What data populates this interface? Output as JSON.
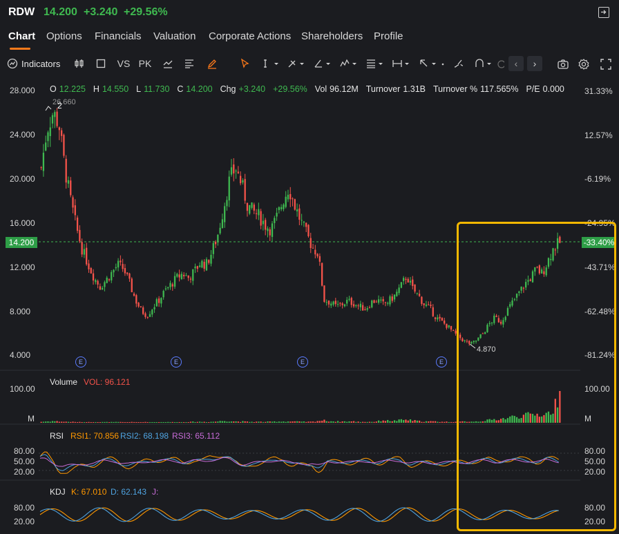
{
  "header": {
    "symbol": "RDW",
    "price": "14.200",
    "change": "+3.240",
    "change_pct": "+29.56%",
    "up_color": "#3fb950",
    "down_color": "#f5534a"
  },
  "tabs": [
    "Chart",
    "Options",
    "Financials",
    "Valuation",
    "Corporate Actions",
    "Shareholders",
    "Profile"
  ],
  "active_tab": "Chart",
  "toolbar": {
    "indicators_label": "Indicators",
    "vs_label": "VS",
    "pk_label": "PK",
    "icons": [
      "indicators-icon",
      "candlestick-icon",
      "square-icon",
      "vs",
      "pk",
      "line-chart-icon",
      "align-icon",
      "pencil-icon",
      "cursor-icon",
      "vertical-line-icon",
      "pen-tool-icon",
      "angle-icon",
      "pattern-icon",
      "fib-icon",
      "measure-icon",
      "arrow-icon",
      "dot-more-icon",
      "brush-icon",
      "magnet-icon",
      "eraser-icon",
      "prev-icon",
      "next-icon",
      "camera-icon",
      "settings-icon",
      "fullscreen-icon"
    ]
  },
  "info": {
    "open_label": "O",
    "open": "12.225",
    "high_label": "H",
    "high": "14.550",
    "low_label": "L",
    "low": "11.730",
    "close_label": "C",
    "close": "14.200",
    "chg_label": "Chg",
    "chg": "+3.240",
    "chg_pct": "+29.56%",
    "vol_label": "Vol",
    "vol": "96.12M",
    "turnover_label": "Turnover",
    "turnover": "1.31B",
    "turnover_pct_label": "Turnover %",
    "turnover_pct": "117.565%",
    "pe_label": "P/E",
    "pe": "0.000"
  },
  "price_axis": [
    "28.000",
    "24.000",
    "20.000",
    "16.000",
    "12.000",
    "8.000",
    "4.000"
  ],
  "pct_axis": [
    "31.33%",
    "12.57%",
    "-6.19%",
    "-24.95%",
    "-43.71%",
    "-62.48%",
    "-81.24%"
  ],
  "current_price_tag": "14.200",
  "current_pct_tag": "-33.40%",
  "high_marker": "26.660",
  "high_marker_count": "2",
  "low_marker": "4.870",
  "earnings_marker": "E",
  "volume": {
    "label": "Volume",
    "vol_label": "VOL: 96.121",
    "axis_top": "100.00",
    "axis_unit": "M"
  },
  "rsi": {
    "label": "RSI",
    "rsi1": "RSI1: 70.856",
    "rsi2": "RSI2: 68.198",
    "rsi3": "RSI3: 65.112",
    "axis": [
      "80.00",
      "50.00",
      "20.00"
    ],
    "rsi1_color": "#ff9800",
    "rsi2_color": "#4fa3e0",
    "rsi3_color": "#c86cd8"
  },
  "kdj": {
    "label": "KDJ",
    "k": "K: 67.010",
    "d": "D: 62.143",
    "j": "J:",
    "axis": [
      "80.00",
      "20.00"
    ],
    "k_color": "#ff9800",
    "d_color": "#4fa3e0"
  },
  "chart_data": {
    "type": "candlestick",
    "y_range": [
      3.0,
      29.0
    ],
    "price_levels": [
      {
        "label": "28.000",
        "value": 28.0
      },
      {
        "label": "24.000",
        "value": 24.0
      },
      {
        "label": "20.000",
        "value": 20.0
      },
      {
        "label": "16.000",
        "value": 16.0
      },
      {
        "label": "12.000",
        "value": 12.0
      },
      {
        "label": "8.000",
        "value": 8.0
      },
      {
        "label": "4.000",
        "value": 4.0
      }
    ],
    "close_path": [
      21.0,
      24.5,
      26.0,
      25.0,
      21.0,
      18.0,
      15.5,
      13.5,
      12.2,
      11.0,
      10.2,
      10.8,
      11.5,
      12.2,
      11.8,
      10.5,
      9.0,
      8.0,
      7.6,
      8.4,
      9.0,
      9.8,
      10.4,
      11.0,
      11.4,
      11.0,
      11.6,
      12.4,
      12.2,
      13.4,
      15.0,
      17.5,
      20.0,
      21.0,
      19.5,
      17.6,
      17.0,
      16.6,
      15.8,
      15.4,
      16.5,
      18.0,
      19.2,
      17.6,
      16.2,
      15.0,
      13.8,
      13.2,
      9.0,
      8.8,
      8.4,
      8.6,
      8.9,
      8.7,
      8.4,
      8.2,
      8.8,
      9.0,
      8.6,
      8.9,
      9.4,
      10.2,
      11.2,
      10.0,
      9.4,
      8.6,
      8.2,
      7.4,
      7.0,
      6.6,
      6.0,
      5.6,
      5.2,
      5.0,
      5.4,
      6.0,
      6.8,
      7.4,
      7.0,
      8.0,
      8.8,
      9.6,
      10.4,
      11.0,
      11.8,
      11.4,
      12.6,
      13.8,
      14.2
    ],
    "volume_path": [
      3,
      4,
      5,
      4,
      3,
      3,
      2,
      2,
      2,
      2,
      2,
      2,
      2,
      2,
      2,
      2,
      2,
      2,
      2,
      2,
      2,
      2,
      2,
      2,
      2,
      2,
      3,
      3,
      3,
      3,
      4,
      6,
      5,
      4,
      4,
      3,
      3,
      3,
      3,
      3,
      4,
      4,
      4,
      4,
      3,
      3,
      3,
      6,
      7,
      5,
      4,
      4,
      4,
      4,
      3,
      3,
      3,
      4,
      8,
      6,
      6,
      8,
      9,
      7,
      5,
      4,
      4,
      4,
      3,
      3,
      3,
      3,
      4,
      4,
      4,
      6,
      8,
      10,
      12,
      14,
      18,
      20,
      22,
      24,
      26,
      25,
      28,
      40,
      96
    ],
    "earnings_positions": [
      0.12,
      0.35,
      0.55,
      0.82
    ]
  }
}
